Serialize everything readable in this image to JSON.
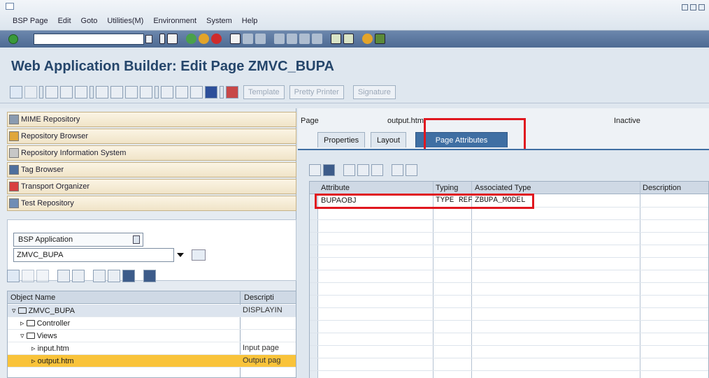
{
  "menu": {
    "items": [
      "BSP Page",
      "Edit",
      "Goto",
      "Utilities(M)",
      "Environment",
      "System",
      "Help"
    ]
  },
  "systoolbar": {
    "command_value": ""
  },
  "title": "Web Application Builder: Edit Page ZMVC_BUPA",
  "app_toolbar": {
    "template_label": "Template",
    "pretty_printer_label": "Pretty Printer",
    "signature_label": "Signature"
  },
  "navigation": {
    "items": [
      {
        "label": "MIME Repository",
        "icon": "mime-icon"
      },
      {
        "label": "Repository Browser",
        "icon": "repository-icon"
      },
      {
        "label": "Repository Information System",
        "icon": "infosystem-icon"
      },
      {
        "label": "Tag Browser",
        "icon": "tag-icon"
      },
      {
        "label": "Transport Organizer",
        "icon": "transport-icon"
      },
      {
        "label": "Test Repository",
        "icon": "test-icon"
      }
    ]
  },
  "object_selector": {
    "type": "BSP Application",
    "name": "ZMVC_BUPA"
  },
  "object_tree": {
    "col_name": "Object Name",
    "col_desc": "Descripti",
    "rows": [
      {
        "name": "ZMVC_BUPA",
        "desc": "DISPLAYIN"
      },
      {
        "name": "Controller",
        "desc": ""
      },
      {
        "name": "Views",
        "desc": ""
      },
      {
        "name": "input.htm",
        "desc": "Input page"
      },
      {
        "name": "output.htm",
        "desc": "Output pag"
      }
    ]
  },
  "page_header": {
    "label": "Page",
    "value": "output.htm",
    "status": "Inactive"
  },
  "tabs": [
    "Properties",
    "Layout",
    "Page Attributes"
  ],
  "attributes": {
    "columns": [
      "Attribute",
      "Typing",
      "Associated Type",
      "Description"
    ],
    "rows": [
      {
        "attribute": "BUPAOBJ",
        "typing": "TYPE REF",
        "assoc": "ZBUPA_MODEL",
        "desc": ""
      }
    ]
  },
  "colors": {
    "title": "#25466b",
    "active_tab": "#3f6fa3",
    "highlight": "#e0171f",
    "selected_row": "#f9c33a"
  }
}
